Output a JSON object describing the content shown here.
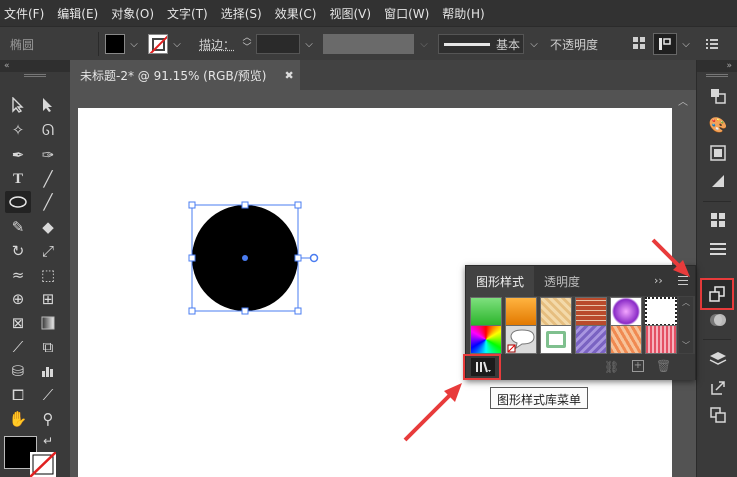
{
  "menu": [
    "文件(F)",
    "编辑(E)",
    "对象(O)",
    "文字(T)",
    "选择(S)",
    "效果(C)",
    "视图(V)",
    "窗口(W)",
    "帮助(H)"
  ],
  "control_bar": {
    "shape_label": "椭圆",
    "stroke_label": "描边：",
    "stroke_profile": "基本",
    "opacity_label": "不透明度"
  },
  "document_tab": {
    "title": "未标题-2* @ 91.15% (RGB/预览)",
    "close_glyph": "✖"
  },
  "graphic_styles_panel": {
    "tab_active": "图形样式",
    "tab_inactive": "透明度",
    "library_menu_tooltip": "图形样式库菜单"
  },
  "colors": {
    "fill": "#000000",
    "stroke": "none",
    "highlight": "#e83b3b",
    "selection": "#4a7cf0"
  }
}
